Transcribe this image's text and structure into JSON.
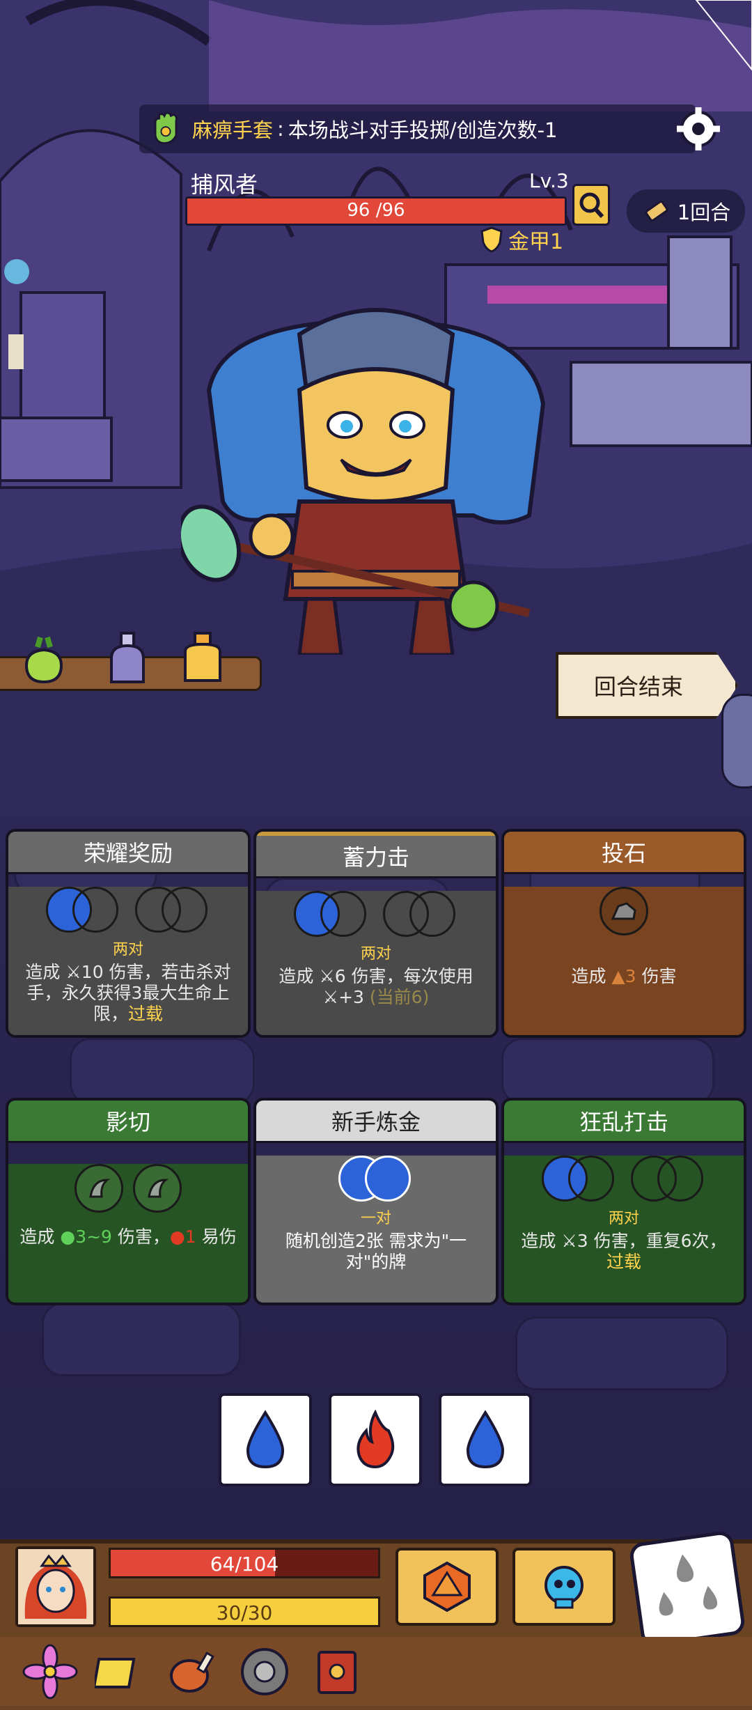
{
  "relic": {
    "name": "麻痹手套",
    "separator": ":",
    "effect": "本场战斗对手投掷/创造次数-1"
  },
  "enemy": {
    "name": "捕风者",
    "level": "Lv.3",
    "hp_text": "96 /96",
    "hp_fraction": 1.0,
    "armor": "金甲1"
  },
  "turn": {
    "label": "1回合"
  },
  "end_turn": {
    "label": "回合结束"
  },
  "cards": [
    {
      "title": "荣耀奖励",
      "req": "两对",
      "desc_pre": "造成 ",
      "desc_mid": "10 伤害，若击杀对手，永久获得3最大生命上限，",
      "desc_kw": "过载"
    },
    {
      "title": "蓄力击",
      "req": "两对",
      "desc_pre": "造成 ",
      "desc_mid": "6 伤害，每次使用",
      "desc_mid2": "+3 ",
      "desc_dim": "(当前6)"
    },
    {
      "title": "投石",
      "desc_pre": "造成 ",
      "desc_num": "3",
      "desc_post": " 伤害"
    },
    {
      "title": "影切",
      "desc_pre": "造成 ",
      "desc_num": "3~9",
      "desc_mid": " 伤害，",
      "desc_num2": "1",
      "desc_post": " 易伤"
    },
    {
      "title": "新手炼金",
      "req": "一对",
      "desc": "随机创造2张 需求为\"一对\"的牌"
    },
    {
      "title": "狂乱打击",
      "req": "两对",
      "desc_pre": "造成 ",
      "desc_mid": "3 伤害，重复6次，",
      "desc_kw": "过载"
    }
  ],
  "dice": [
    {
      "face": "water-drop-icon",
      "color": "#2d63d8"
    },
    {
      "face": "fire-icon",
      "color": "#e33a24"
    },
    {
      "face": "water-drop-icon",
      "color": "#2d63d8"
    }
  ],
  "player": {
    "hp_text": "64/104",
    "hp_fraction": 0.615,
    "energy_text": "30/30",
    "energy_fraction": 1.0
  },
  "colors": {
    "hp_red": "#e2483a",
    "energy_yellow": "#f5cf3e",
    "gold": "#ffd34d"
  }
}
